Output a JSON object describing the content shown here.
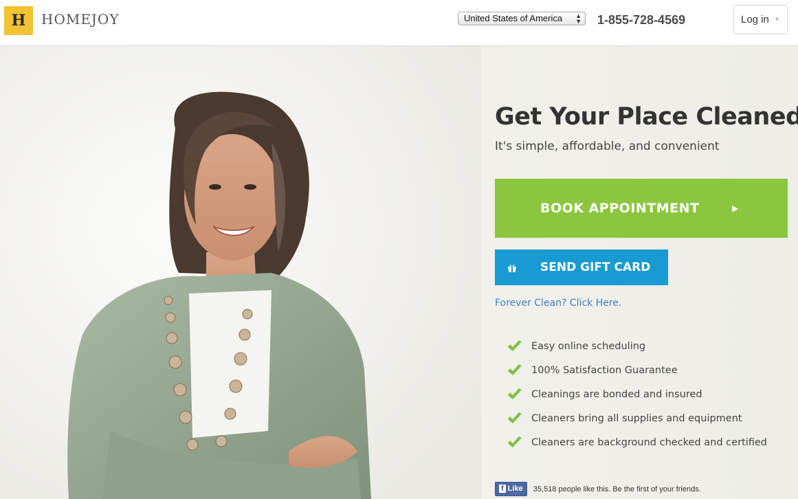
{
  "header": {
    "logo_letter": "H",
    "logo_text": "HOMEJOY",
    "country_select": {
      "selected": "United States of America"
    },
    "phone": "1-855-728-4569",
    "login_label": "Log in"
  },
  "hero": {
    "headline": "Get Your Place Cleaned",
    "subhead": "It's simple, affordable, and convenient",
    "book_label": "BOOK APPOINTMENT",
    "gift_label": "SEND GIFT CARD",
    "forever_link": "Forever Clean? Click Here.",
    "features": [
      "Easy online scheduling",
      "100% Satisfaction Guarantee",
      "Cleanings are bonded and insured",
      "Cleaners bring all supplies and equipment",
      "Cleaners are background checked and certified"
    ],
    "facebook": {
      "like_label": "Like",
      "count_text": "35,518 people like this. Be the first of your friends."
    }
  },
  "colors": {
    "logo_yellow": "#f1c232",
    "book_green": "#8cc63f",
    "gift_blue": "#179bd0",
    "link_blue": "#3f7fbf",
    "check_green": "#7cc242"
  }
}
